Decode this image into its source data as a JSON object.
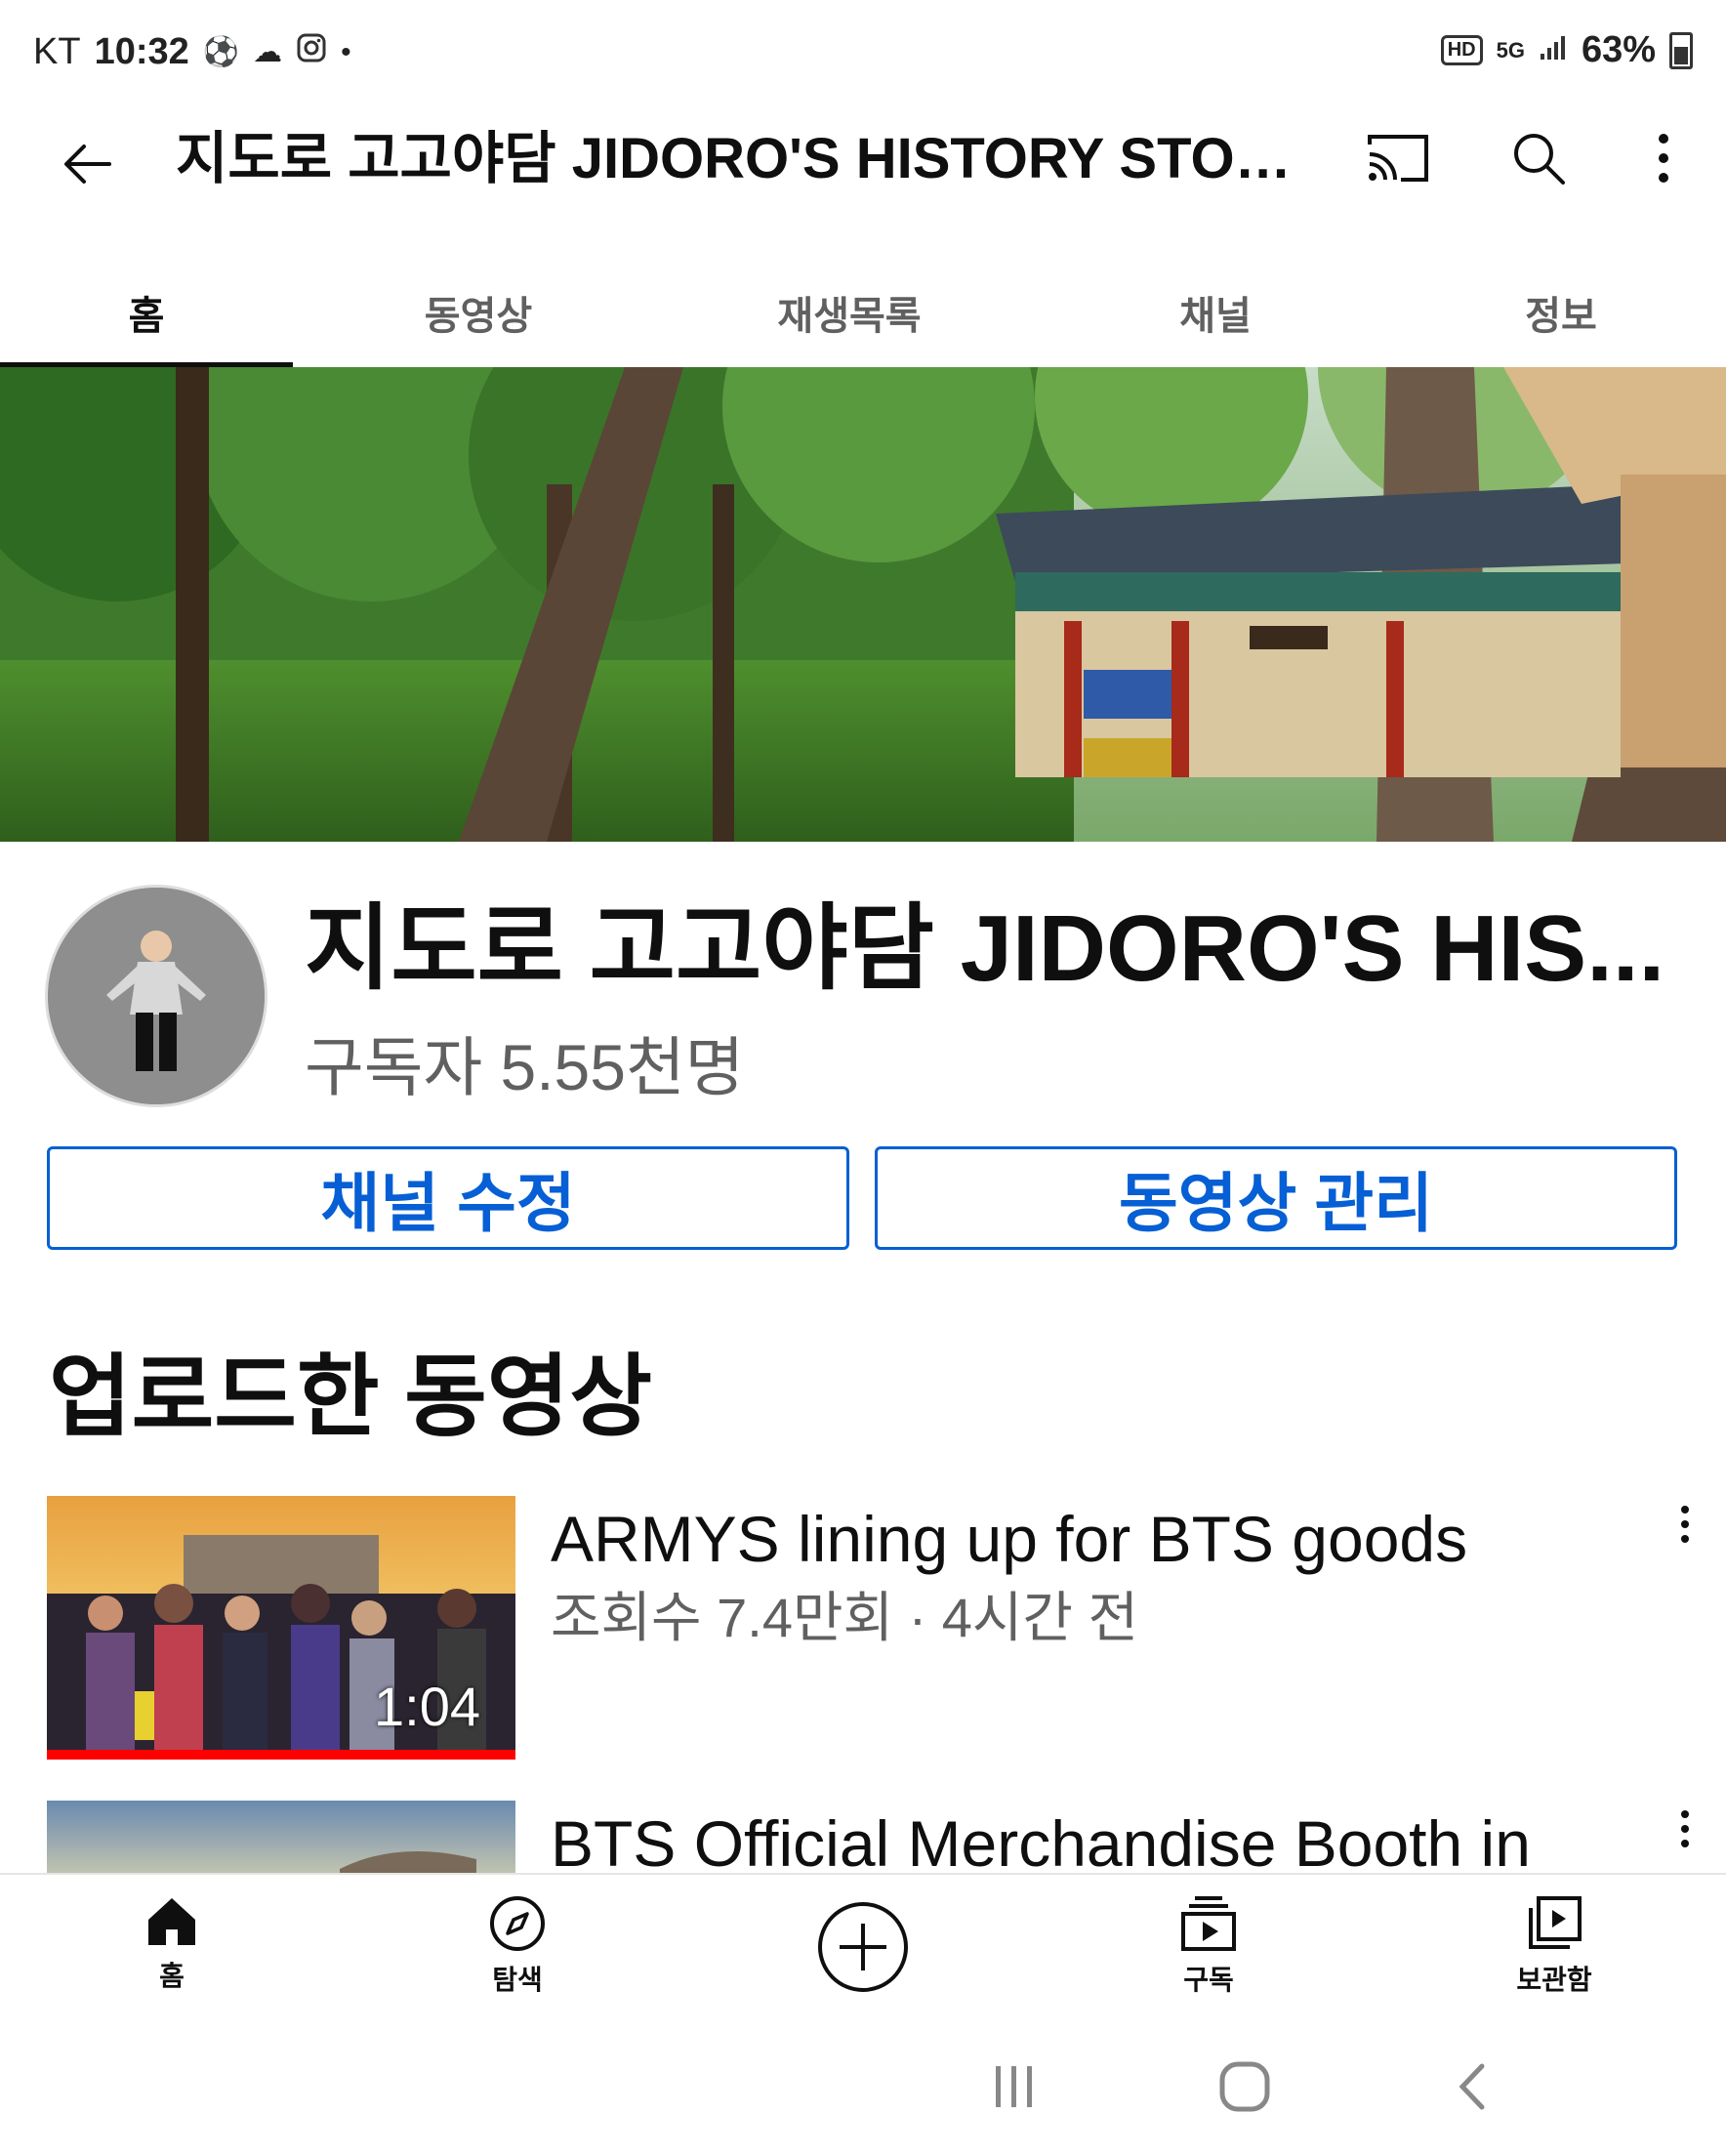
{
  "status_bar": {
    "carrier": "KT",
    "time": "10:32",
    "battery": "63%",
    "network": "5G"
  },
  "app_bar": {
    "title": "지도로 고고야담 JIDORO'S HISTORY STORA..."
  },
  "tabs": [
    {
      "label": "홈",
      "active": true
    },
    {
      "label": "동영상",
      "active": false
    },
    {
      "label": "재생목록",
      "active": false
    },
    {
      "label": "채널",
      "active": false
    },
    {
      "label": "정보",
      "active": false
    }
  ],
  "channel": {
    "name": "지도로 고고야담 JIDORO'S HIS...",
    "subscribers": "구독자 5.55천명"
  },
  "actions": {
    "edit_channel": "채널 수정",
    "manage_videos": "동영상 관리"
  },
  "section": {
    "title": "업로드한 동영상"
  },
  "videos": [
    {
      "title": "ARMYS lining up for BTS goods",
      "meta": "조회수 7.4만회 · 4시간 전",
      "duration": "1:04",
      "watched_fraction": 1.0
    },
    {
      "title": "BTS Official Merchandise Booth in",
      "meta": "",
      "duration": ""
    }
  ],
  "bottom_nav": [
    {
      "label": "홈",
      "icon": "home-icon"
    },
    {
      "label": "탐색",
      "icon": "explore-icon"
    },
    {
      "label": "",
      "icon": "create-icon"
    },
    {
      "label": "구독",
      "icon": "subscriptions-icon"
    },
    {
      "label": "보관함",
      "icon": "library-icon"
    }
  ],
  "colors": {
    "accent": "#065fd4",
    "progress": "#ff0000",
    "secondary_text": "#606060"
  }
}
